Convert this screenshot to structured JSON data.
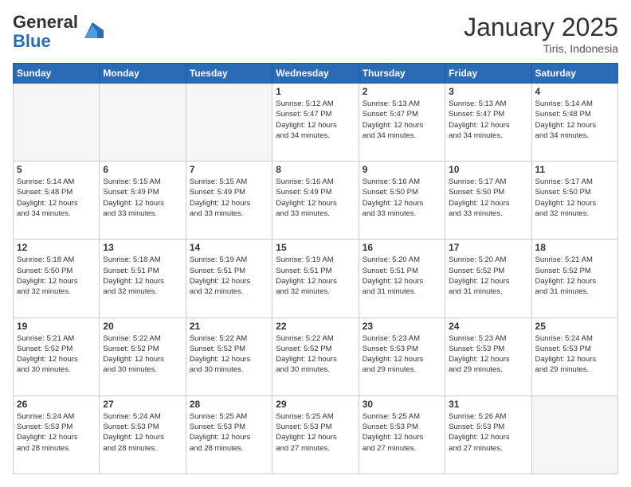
{
  "header": {
    "logo_line1": "General",
    "logo_line2": "Blue",
    "month": "January 2025",
    "location": "Tiris, Indonesia"
  },
  "weekdays": [
    "Sunday",
    "Monday",
    "Tuesday",
    "Wednesday",
    "Thursday",
    "Friday",
    "Saturday"
  ],
  "weeks": [
    [
      {
        "day": "",
        "info": ""
      },
      {
        "day": "",
        "info": ""
      },
      {
        "day": "",
        "info": ""
      },
      {
        "day": "1",
        "info": "Sunrise: 5:12 AM\nSunset: 5:47 PM\nDaylight: 12 hours\nand 34 minutes."
      },
      {
        "day": "2",
        "info": "Sunrise: 5:13 AM\nSunset: 5:47 PM\nDaylight: 12 hours\nand 34 minutes."
      },
      {
        "day": "3",
        "info": "Sunrise: 5:13 AM\nSunset: 5:47 PM\nDaylight: 12 hours\nand 34 minutes."
      },
      {
        "day": "4",
        "info": "Sunrise: 5:14 AM\nSunset: 5:48 PM\nDaylight: 12 hours\nand 34 minutes."
      }
    ],
    [
      {
        "day": "5",
        "info": "Sunrise: 5:14 AM\nSunset: 5:48 PM\nDaylight: 12 hours\nand 34 minutes."
      },
      {
        "day": "6",
        "info": "Sunrise: 5:15 AM\nSunset: 5:49 PM\nDaylight: 12 hours\nand 33 minutes."
      },
      {
        "day": "7",
        "info": "Sunrise: 5:15 AM\nSunset: 5:49 PM\nDaylight: 12 hours\nand 33 minutes."
      },
      {
        "day": "8",
        "info": "Sunrise: 5:16 AM\nSunset: 5:49 PM\nDaylight: 12 hours\nand 33 minutes."
      },
      {
        "day": "9",
        "info": "Sunrise: 5:16 AM\nSunset: 5:50 PM\nDaylight: 12 hours\nand 33 minutes."
      },
      {
        "day": "10",
        "info": "Sunrise: 5:17 AM\nSunset: 5:50 PM\nDaylight: 12 hours\nand 33 minutes."
      },
      {
        "day": "11",
        "info": "Sunrise: 5:17 AM\nSunset: 5:50 PM\nDaylight: 12 hours\nand 32 minutes."
      }
    ],
    [
      {
        "day": "12",
        "info": "Sunrise: 5:18 AM\nSunset: 5:50 PM\nDaylight: 12 hours\nand 32 minutes."
      },
      {
        "day": "13",
        "info": "Sunrise: 5:18 AM\nSunset: 5:51 PM\nDaylight: 12 hours\nand 32 minutes."
      },
      {
        "day": "14",
        "info": "Sunrise: 5:19 AM\nSunset: 5:51 PM\nDaylight: 12 hours\nand 32 minutes."
      },
      {
        "day": "15",
        "info": "Sunrise: 5:19 AM\nSunset: 5:51 PM\nDaylight: 12 hours\nand 32 minutes."
      },
      {
        "day": "16",
        "info": "Sunrise: 5:20 AM\nSunset: 5:51 PM\nDaylight: 12 hours\nand 31 minutes."
      },
      {
        "day": "17",
        "info": "Sunrise: 5:20 AM\nSunset: 5:52 PM\nDaylight: 12 hours\nand 31 minutes."
      },
      {
        "day": "18",
        "info": "Sunrise: 5:21 AM\nSunset: 5:52 PM\nDaylight: 12 hours\nand 31 minutes."
      }
    ],
    [
      {
        "day": "19",
        "info": "Sunrise: 5:21 AM\nSunset: 5:52 PM\nDaylight: 12 hours\nand 30 minutes."
      },
      {
        "day": "20",
        "info": "Sunrise: 5:22 AM\nSunset: 5:52 PM\nDaylight: 12 hours\nand 30 minutes."
      },
      {
        "day": "21",
        "info": "Sunrise: 5:22 AM\nSunset: 5:52 PM\nDaylight: 12 hours\nand 30 minutes."
      },
      {
        "day": "22",
        "info": "Sunrise: 5:22 AM\nSunset: 5:52 PM\nDaylight: 12 hours\nand 30 minutes."
      },
      {
        "day": "23",
        "info": "Sunrise: 5:23 AM\nSunset: 5:53 PM\nDaylight: 12 hours\nand 29 minutes."
      },
      {
        "day": "24",
        "info": "Sunrise: 5:23 AM\nSunset: 5:53 PM\nDaylight: 12 hours\nand 29 minutes."
      },
      {
        "day": "25",
        "info": "Sunrise: 5:24 AM\nSunset: 5:53 PM\nDaylight: 12 hours\nand 29 minutes."
      }
    ],
    [
      {
        "day": "26",
        "info": "Sunrise: 5:24 AM\nSunset: 5:53 PM\nDaylight: 12 hours\nand 28 minutes."
      },
      {
        "day": "27",
        "info": "Sunrise: 5:24 AM\nSunset: 5:53 PM\nDaylight: 12 hours\nand 28 minutes."
      },
      {
        "day": "28",
        "info": "Sunrise: 5:25 AM\nSunset: 5:53 PM\nDaylight: 12 hours\nand 28 minutes."
      },
      {
        "day": "29",
        "info": "Sunrise: 5:25 AM\nSunset: 5:53 PM\nDaylight: 12 hours\nand 27 minutes."
      },
      {
        "day": "30",
        "info": "Sunrise: 5:25 AM\nSunset: 5:53 PM\nDaylight: 12 hours\nand 27 minutes."
      },
      {
        "day": "31",
        "info": "Sunrise: 5:26 AM\nSunset: 5:53 PM\nDaylight: 12 hours\nand 27 minutes."
      },
      {
        "day": "",
        "info": ""
      }
    ]
  ]
}
